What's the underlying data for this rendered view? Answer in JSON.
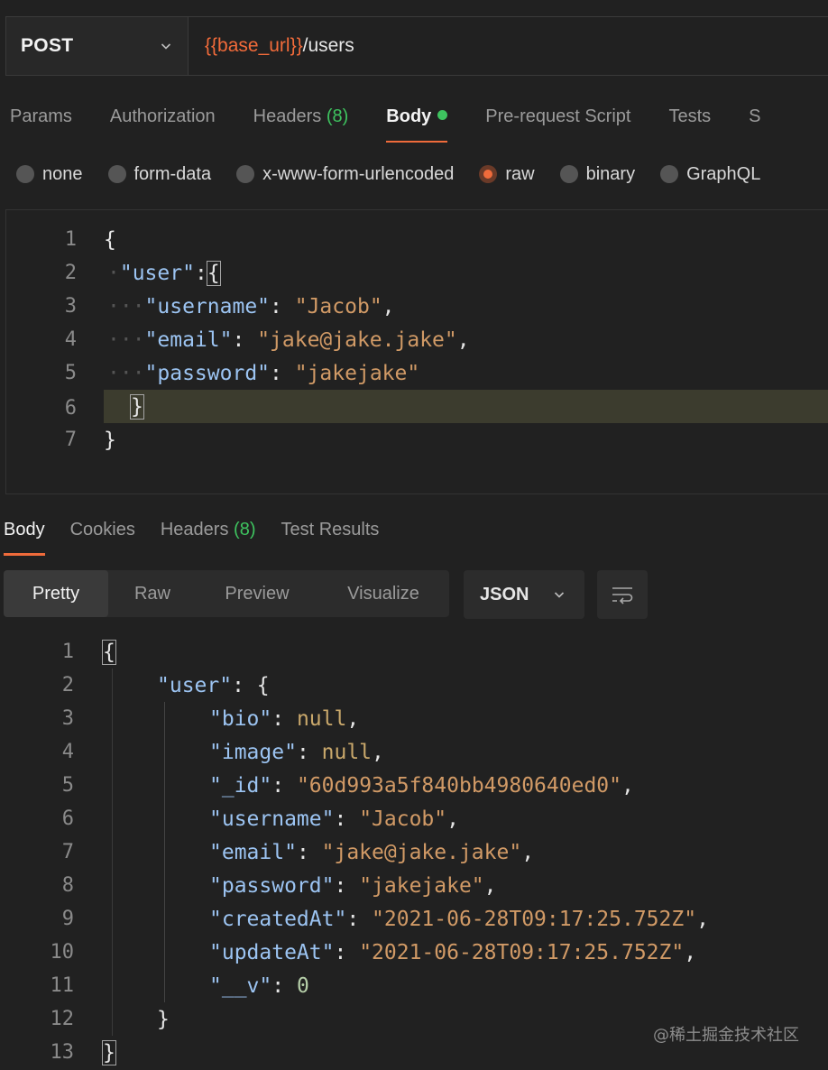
{
  "request": {
    "method": "POST",
    "url_variable": "{{base_url}}",
    "url_path": "/users"
  },
  "request_tabs": [
    {
      "label": "Params"
    },
    {
      "label": "Authorization"
    },
    {
      "label": "Headers",
      "count": "(8)"
    },
    {
      "label": "Body"
    },
    {
      "label": "Pre-request Script"
    },
    {
      "label": "Tests"
    },
    {
      "label": "S"
    }
  ],
  "body_types": [
    "none",
    "form-data",
    "x-www-form-urlencoded",
    "raw",
    "binary",
    "GraphQL"
  ],
  "selected_body_type": "raw",
  "request_body": {
    "line_numbers": [
      "1",
      "2",
      "3",
      "4",
      "5",
      "6",
      "7"
    ],
    "k_user": "\"user\"",
    "k_username": "\"username\"",
    "v_username": "\"Jacob\"",
    "k_email": "\"email\"",
    "v_email": "\"jake@jake.jake\"",
    "k_password": "\"password\"",
    "v_password": "\"jakejake\""
  },
  "response_tabs": [
    {
      "label": "Body"
    },
    {
      "label": "Cookies"
    },
    {
      "label": "Headers",
      "count": "(8)"
    },
    {
      "label": "Test Results"
    }
  ],
  "view_modes": [
    "Pretty",
    "Raw",
    "Preview",
    "Visualize"
  ],
  "format": "JSON",
  "response_body": {
    "line_numbers": [
      "1",
      "2",
      "3",
      "4",
      "5",
      "6",
      "7",
      "8",
      "9",
      "10",
      "11",
      "12",
      "13"
    ],
    "k_user": "\"user\"",
    "k_bio": "\"bio\"",
    "v_bio": "null",
    "k_image": "\"image\"",
    "v_image": "null",
    "k_id": "\"_id\"",
    "v_id": "\"60d993a5f840bb4980640ed0\"",
    "k_username": "\"username\"",
    "v_username": "\"Jacob\"",
    "k_email": "\"email\"",
    "v_email": "\"jake@jake.jake\"",
    "k_password": "\"password\"",
    "v_password": "\"jakejake\"",
    "k_createdAt": "\"createdAt\"",
    "v_createdAt": "\"2021-06-28T09:17:25.752Z\"",
    "k_updateAt": "\"updateAt\"",
    "v_updateAt": "\"2021-06-28T09:17:25.752Z\"",
    "k_v": "\"__v\"",
    "v_v": "0"
  },
  "watermark": "@稀土掘金技术社区"
}
